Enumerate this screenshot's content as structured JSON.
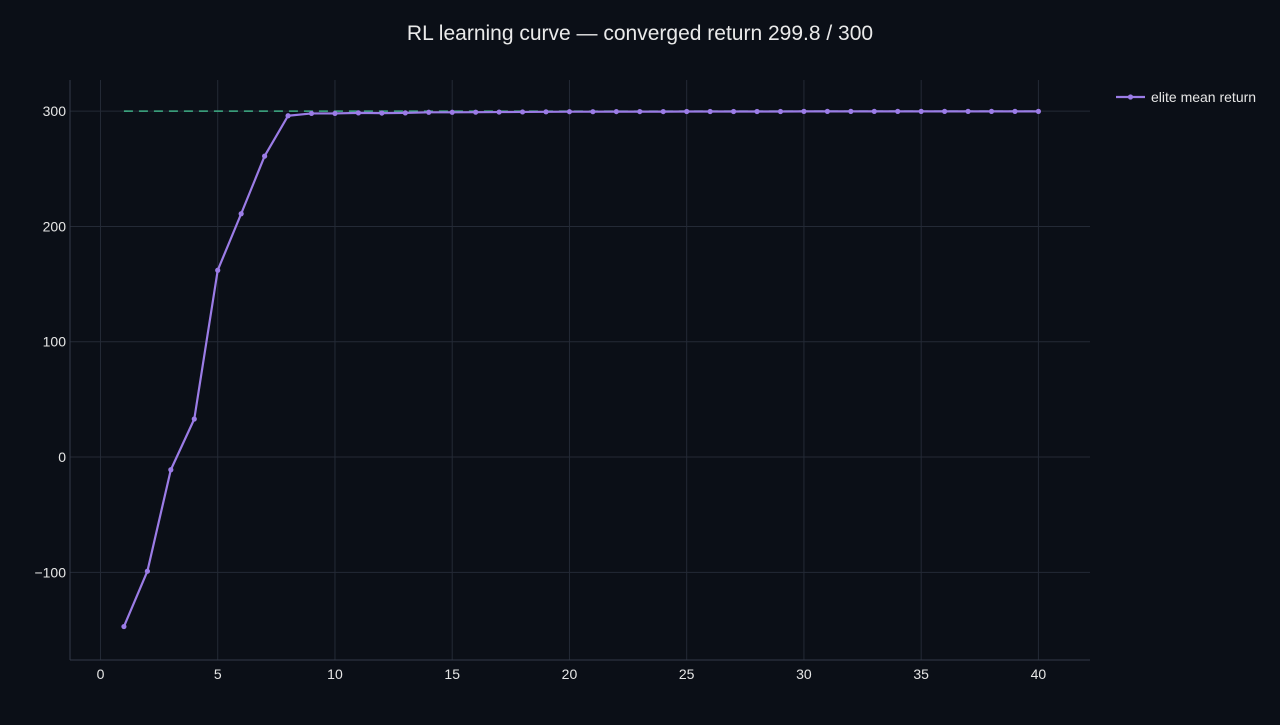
{
  "colors": {
    "background": "#0b0f17",
    "grid": "#242a36",
    "axis_line": "#333a48",
    "tick_text": "#e6e6e6",
    "title_text": "#eaeaea",
    "series": "#9b7ce6",
    "target_line": "#3fae86"
  },
  "chart_data": {
    "type": "line",
    "title": "RL learning curve — converged return 299.8 / 300",
    "xlabel": "",
    "ylabel": "",
    "xlim": [
      -1.3,
      42.2
    ],
    "ylim": [
      -176,
      327
    ],
    "grid": true,
    "legend_placement": "top-right outside",
    "x_ticks": [
      0,
      5,
      10,
      15,
      20,
      25,
      30,
      35,
      40
    ],
    "x_tick_labels": [
      "0",
      "5",
      "10",
      "15",
      "20",
      "25",
      "30",
      "35",
      "40"
    ],
    "y_ticks": [
      -100,
      0,
      100,
      200,
      300
    ],
    "y_tick_labels": [
      "−100",
      "0",
      "100",
      "200",
      "300"
    ],
    "series": [
      {
        "name": "elite mean return",
        "x": [
          1,
          2,
          3,
          4,
          5,
          6,
          7,
          8,
          9,
          10,
          11,
          12,
          13,
          14,
          15,
          16,
          17,
          18,
          19,
          20,
          21,
          22,
          23,
          24,
          25,
          26,
          27,
          28,
          29,
          30,
          31,
          32,
          33,
          34,
          35,
          36,
          37,
          38,
          39,
          40
        ],
        "y": [
          -147,
          -99,
          -11,
          33,
          162,
          211,
          261,
          296,
          298,
          298,
          298.5,
          298.3,
          298.5,
          299,
          299,
          299.1,
          299.2,
          299.3,
          299.4,
          299.5,
          299.5,
          299.6,
          299.6,
          299.6,
          299.7,
          299.7,
          299.7,
          299.7,
          299.7,
          299.8,
          299.8,
          299.8,
          299.8,
          299.8,
          299.8,
          299.8,
          299.8,
          299.8,
          299.8,
          299.8
        ]
      }
    ],
    "reference_lines": [
      {
        "type": "horizontal",
        "y": 300,
        "x_range": [
          1,
          40
        ],
        "style": "dashed"
      }
    ]
  }
}
